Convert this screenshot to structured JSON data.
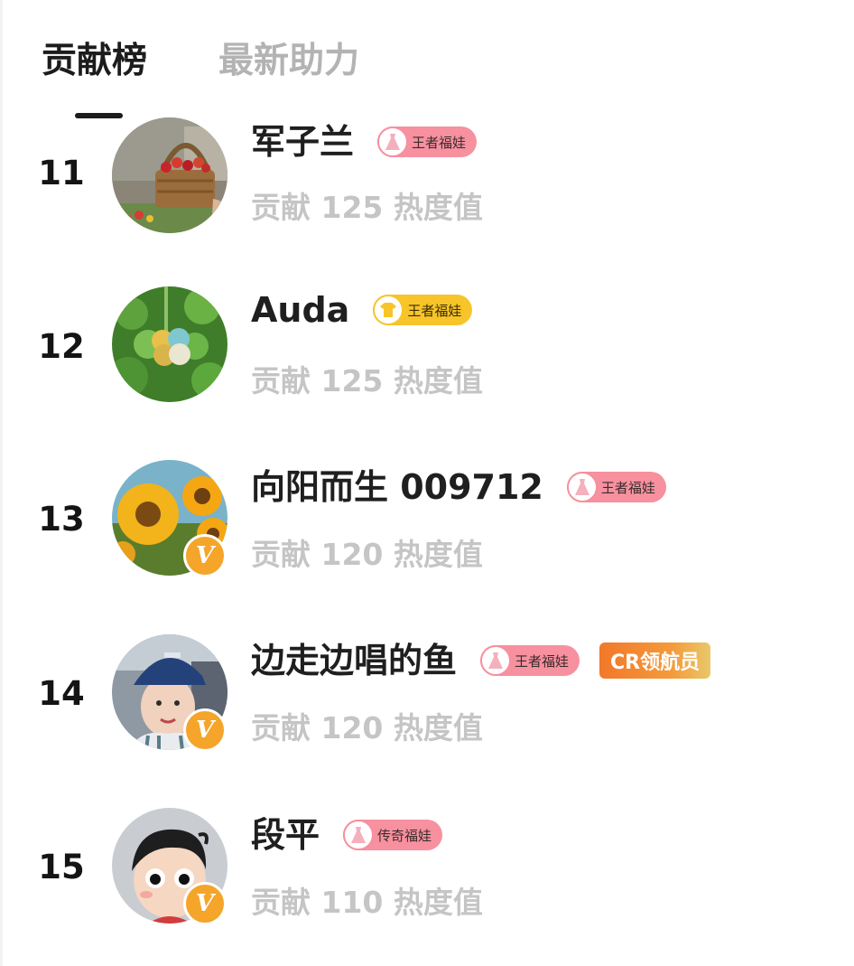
{
  "tabs": {
    "active": "贡献榜",
    "inactive": "最新助力"
  },
  "rows": [
    {
      "rank": "11",
      "name": "军子兰",
      "badges": [
        {
          "text": "王者福娃",
          "style": "pink",
          "icon": "dress-icon"
        }
      ],
      "contribution": "贡献 125 热度值",
      "verified": false,
      "avatar": "fruit-basket-avatar"
    },
    {
      "rank": "12",
      "name": "Auda",
      "badges": [
        {
          "text": "王者福娃",
          "style": "yellow",
          "icon": "shirt-icon"
        }
      ],
      "contribution": "贡献 125 热度值",
      "verified": false,
      "avatar": "clover-avatar"
    },
    {
      "rank": "13",
      "name": "向阳而生 009712",
      "badges": [
        {
          "text": "王者福娃",
          "style": "pink",
          "icon": "dress-icon"
        }
      ],
      "contribution": "贡献 120 热度值",
      "verified": true,
      "avatar": "sunflower-avatar"
    },
    {
      "rank": "14",
      "name": "边走边唱的鱼",
      "badges": [
        {
          "text": "王者福娃",
          "style": "pink",
          "icon": "dress-icon"
        }
      ],
      "cr_badge": "CR领航员",
      "contribution": "贡献 120 热度值",
      "verified": true,
      "avatar": "person-cap-avatar"
    },
    {
      "rank": "15",
      "name": "段平",
      "badges": [
        {
          "text": "传奇福娃",
          "style": "pink",
          "icon": "dress-icon"
        }
      ],
      "contribution": "贡献 110 热度值",
      "verified": true,
      "avatar": "cartoon-avatar"
    }
  ],
  "verified_mark": "V",
  "colors": {
    "badge_pink": "#f7909f",
    "badge_yellow": "#f7c52a",
    "verified_orange": "#f4a52a",
    "cr_orange": "#f2782a",
    "muted_text": "#c5c5c5",
    "inactive_tab": "#b3b3b3"
  }
}
